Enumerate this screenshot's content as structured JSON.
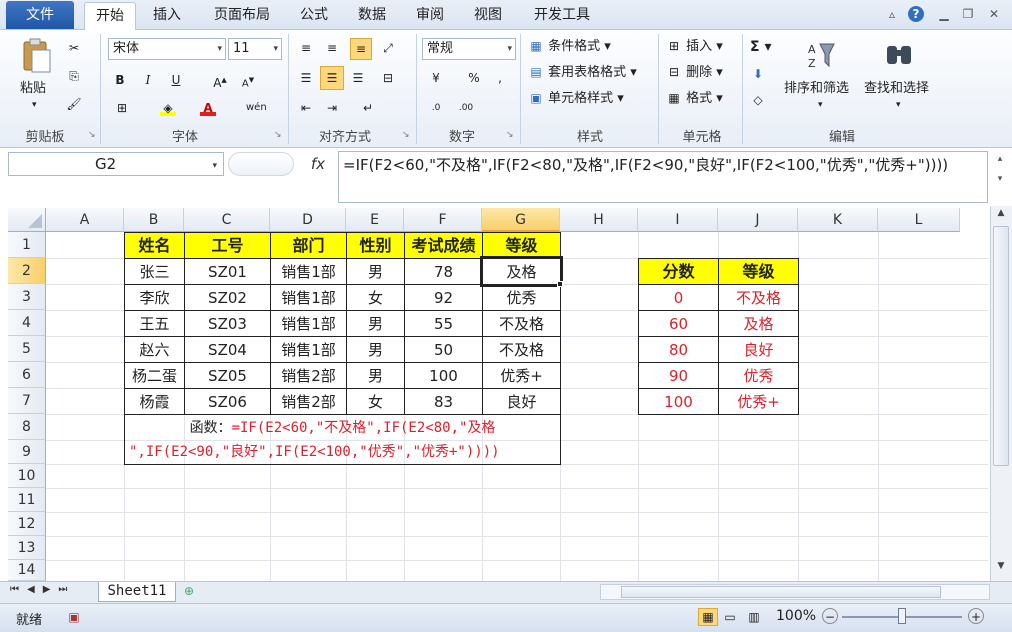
{
  "tabs": {
    "file": "文件",
    "home": "开始",
    "insert": "插入",
    "layout": "页面布局",
    "formulas": "公式",
    "data": "数据",
    "review": "审阅",
    "view": "视图",
    "developer": "开发工具"
  },
  "ribbon": {
    "clipboard": {
      "paste": "粘贴",
      "label": "剪贴板"
    },
    "font": {
      "name": "宋体",
      "size": "11",
      "label": "字体",
      "bold": "B",
      "italic": "I",
      "underline": "U"
    },
    "alignment": {
      "label": "对齐方式"
    },
    "number": {
      "format": "常规",
      "label": "数字",
      "percent": "%"
    },
    "styles": {
      "conditional": "条件格式",
      "table": "套用表格格式",
      "cell": "单元格样式",
      "label": "样式"
    },
    "cells": {
      "insert": "插入",
      "delete": "删除",
      "format": "格式",
      "label": "单元格"
    },
    "editing": {
      "sigma": "Σ",
      "sort": "排序和筛选",
      "find": "查找和选择",
      "label": "编辑"
    }
  },
  "formula_bar": {
    "name_box": "G2",
    "fx": "fx",
    "formula": "=IF(F2<60,\"不及格\",IF(F2<80,\"及格\",IF(F2<90,\"良好\",IF(F2<100,\"优秀\",\"优秀+\"))))"
  },
  "columns": [
    "A",
    "B",
    "C",
    "D",
    "E",
    "F",
    "G",
    "H",
    "I",
    "J",
    "K",
    "L"
  ],
  "rows": [
    "1",
    "2",
    "3",
    "4",
    "5",
    "6",
    "7",
    "8",
    "9",
    "10",
    "11",
    "12",
    "13",
    "14"
  ],
  "table1": {
    "headers": [
      "姓名",
      "工号",
      "部门",
      "性别",
      "考试成绩",
      "等级"
    ],
    "rows": [
      [
        "张三",
        "SZ01",
        "销售1部",
        "男",
        "78",
        "及格"
      ],
      [
        "李欣",
        "SZ02",
        "销售1部",
        "女",
        "92",
        "优秀"
      ],
      [
        "王五",
        "SZ03",
        "销售1部",
        "男",
        "55",
        "不及格"
      ],
      [
        "赵六",
        "SZ04",
        "销售1部",
        "男",
        "50",
        "不及格"
      ],
      [
        "杨二蛋",
        "SZ05",
        "销售2部",
        "男",
        "100",
        "优秀+"
      ],
      [
        "杨霞",
        "SZ06",
        "销售2部",
        "女",
        "83",
        "良好"
      ]
    ],
    "note_prefix": "函数：",
    "note_line1": "=IF(E2<60,\"不及格\",IF(E2<80,\"及格",
    "note_line2": "\",IF(E2<90,\"良好\",IF(E2<100,\"优秀\",\"优秀+\"))))"
  },
  "table2": {
    "headers": [
      "分数",
      "等级"
    ],
    "rows": [
      [
        "0",
        "不及格"
      ],
      [
        "60",
        "及格"
      ],
      [
        "80",
        "良好"
      ],
      [
        "90",
        "优秀"
      ],
      [
        "100",
        "优秀+"
      ]
    ]
  },
  "sheet_tab": "Sheet11",
  "status": {
    "ready": "就绪",
    "zoom": "100%"
  }
}
